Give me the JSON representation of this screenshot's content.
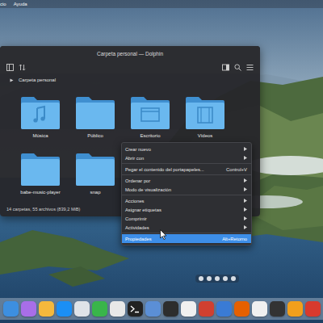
{
  "menubar": {
    "items": [
      "cio",
      "Ayuda"
    ]
  },
  "window": {
    "title": "Carpeta personal — Dolphin"
  },
  "breadcrumb": {
    "label": "Carpeta personal"
  },
  "folders": [
    {
      "name": "Música",
      "kind": "music"
    },
    {
      "name": "Público",
      "kind": "plain"
    },
    {
      "name": "Escritorio",
      "kind": "desktop"
    },
    {
      "name": "Vídeos",
      "kind": "video"
    },
    {
      "name": "babe-music-player",
      "kind": "plain"
    },
    {
      "name": "snap",
      "kind": "plain"
    }
  ],
  "status_bar": "14 carpetas, 55 archivos (839,2 MiB)",
  "context_menu": {
    "groups": [
      [
        {
          "label": "Crear nuevo",
          "shortcut": "",
          "submenu": true,
          "selected": false
        },
        {
          "label": "Abrir con",
          "shortcut": "",
          "submenu": true,
          "selected": false
        }
      ],
      [
        {
          "label": "Pegar el contenido del portapapeles...",
          "shortcut": "Control+V",
          "submenu": false,
          "selected": false
        }
      ],
      [
        {
          "label": "Ordenar por",
          "shortcut": "",
          "submenu": true,
          "selected": false
        },
        {
          "label": "Modo de visualización",
          "shortcut": "",
          "submenu": true,
          "selected": false
        }
      ],
      [
        {
          "label": "Acciones",
          "shortcut": "",
          "submenu": true,
          "selected": false
        },
        {
          "label": "Asignar etiquetas",
          "shortcut": "",
          "submenu": true,
          "selected": false
        },
        {
          "label": "Comprimir",
          "shortcut": "",
          "submenu": true,
          "selected": false
        },
        {
          "label": "Actividades",
          "shortcut": "",
          "submenu": true,
          "selected": false
        }
      ],
      [
        {
          "label": "Propiedades",
          "shortcut": "Alt+Retorno",
          "submenu": false,
          "selected": true
        }
      ]
    ]
  }
}
